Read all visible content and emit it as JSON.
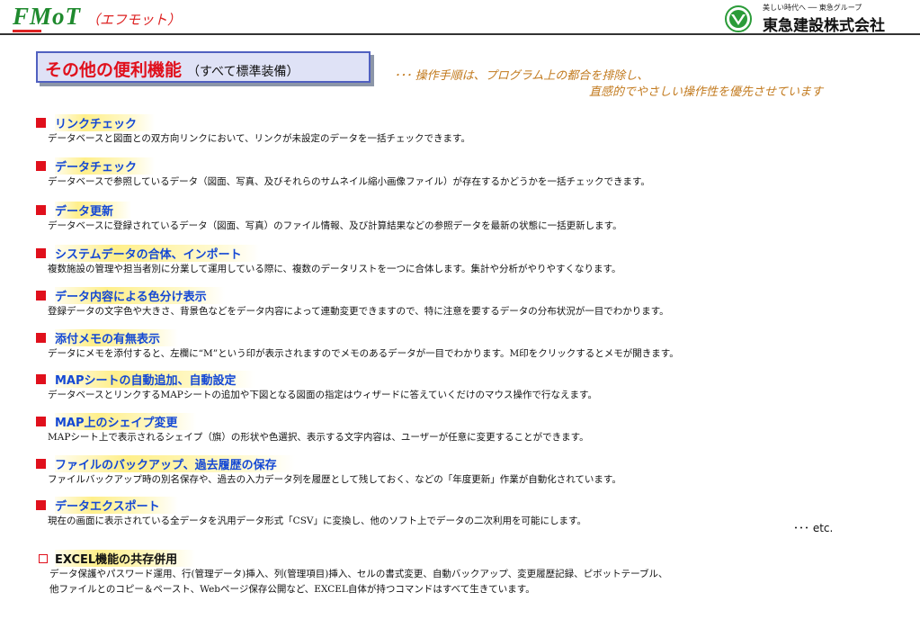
{
  "header": {
    "brand": "FMoT",
    "brand_sub": "（エフモット）",
    "logo_tagline": "美しい時代へ ── 東急グループ",
    "logo_name": "東急建設株式会社"
  },
  "title": {
    "main": "その他の便利機能",
    "sub": "（すべて標準装備）"
  },
  "note": {
    "line1": "･･･ 操作手順は、プログラム上の都合を排除し、",
    "line2": "直感的でやさしい操作性を優先させています"
  },
  "features": [
    {
      "title": "リンクチェック",
      "desc": "データベースと図面との双方向リンクにおいて、リンクが未設定のデータを一括チェックできます。"
    },
    {
      "title": "データチェック",
      "desc": "データベースで参照しているデータ（図面、写真、及びそれらのサムネイル縮小画像ファイル）が存在するかどうかを一括チェックできます。"
    },
    {
      "title": "データ更新",
      "desc": "データベースに登録されているデータ（図面、写真）のファイル情報、及び計算結果などの参照データを最新の状態に一括更新します。"
    },
    {
      "title": "システムデータの合体、インポート",
      "desc": "複数施設の管理や担当者別に分業して運用している際に、複数のデータリストを一つに合体します。集計や分析がやりやすくなります。"
    },
    {
      "title": "データ内容による色分け表示",
      "desc": "登録データの文字色や大きさ、背景色などをデータ内容によって連動変更できますので、特に注意を要するデータの分布状況が一目でわかります。"
    },
    {
      "title": "添付メモの有無表示",
      "desc": "データにメモを添付すると、左欄に“M”という印が表示されますのでメモのあるデータが一目でわかります。M印をクリックするとメモが開きます。"
    },
    {
      "title": "MAPシートの自動追加、自動設定",
      "desc": "データベースとリンクするMAPシートの追加や下図となる図面の指定はウィザードに答えていくだけのマウス操作で行なえます。"
    },
    {
      "title": "MAP上のシェイプ変更",
      "desc": "MAPシート上で表示されるシェイプ（旗）の形状や色選択、表示する文字内容は、ユーザーが任意に変更することができます。"
    },
    {
      "title": "ファイルのバックアップ、過去履歴の保存",
      "desc": "ファイルバックアップ時の別名保存や、過去の入力データ列を履歴として残しておく、などの「年度更新」作業が自動化されています。"
    },
    {
      "title": "データエクスポート",
      "desc": "現在の画面に表示されている全データを汎用データ形式「CSV」に変換し、他のソフト上でデータの二次利用を可能にします。"
    }
  ],
  "etc": "･･･ etc.",
  "excel": {
    "title": "EXCEL機能の共存併用",
    "line1": "データ保護やパスワード運用、行(管理データ)挿入、列(管理項目)挿入、セルの書式変更、自動バックアップ、変更履歴記録、ピボットテーブル、",
    "line2": "他ファイルとのコピー＆ペースト、Webページ保存公開など、EXCEL自体が持つコマンドはすべて生きています。"
  },
  "colors": {
    "accent_red": "#e0101c",
    "heading_blue": "#1448d4",
    "brand_green": "#1f8a2e",
    "note_orange": "#c27a1e",
    "highlight_yellow": "#ffef8a"
  }
}
